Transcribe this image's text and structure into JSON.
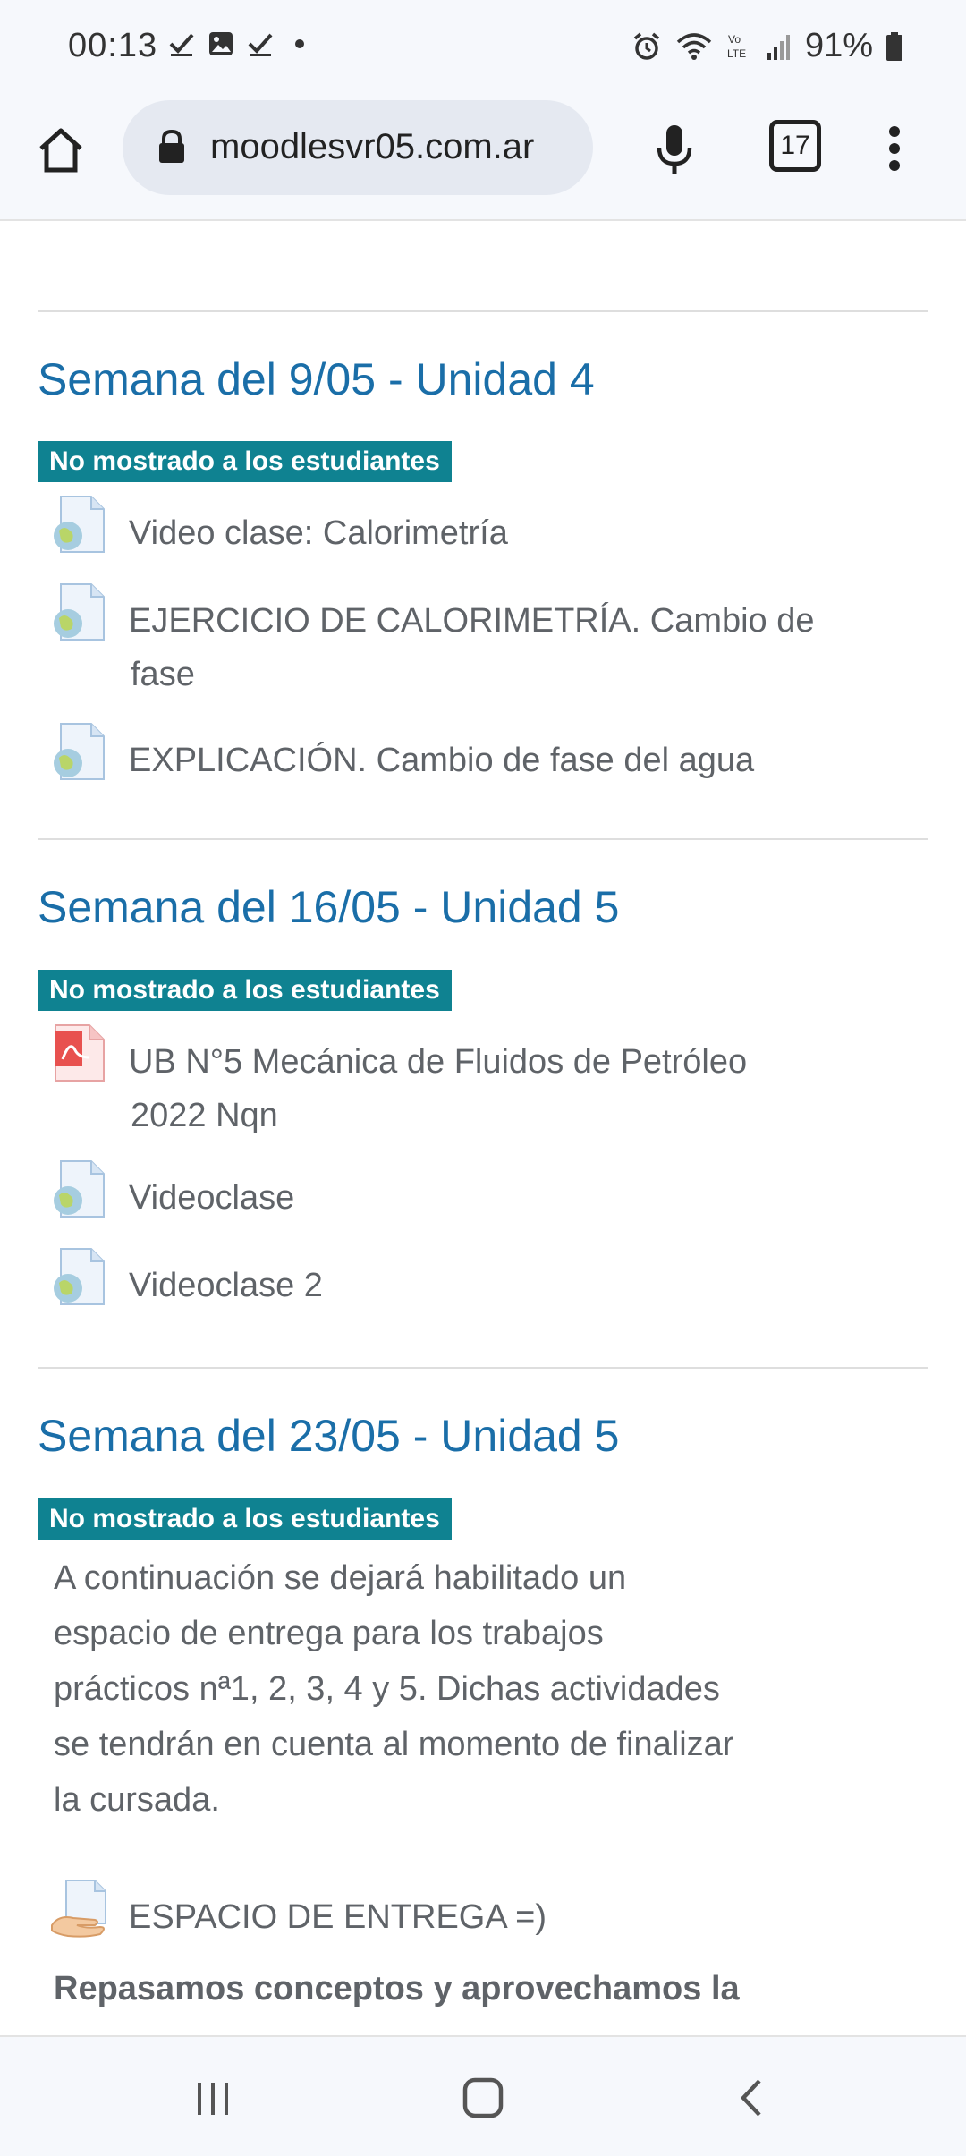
{
  "status_bar": {
    "time": "00:13",
    "battery_percent": "91%",
    "left_icons": [
      "check-icon",
      "image-icon",
      "check-icon",
      "dot-icon"
    ],
    "right_icons": [
      "alarm-icon",
      "wifi-icon",
      "volte-icon",
      "signal-icon",
      "battery-icon"
    ]
  },
  "browser": {
    "url": "moodlesvr05.com.ar",
    "tab_count": "17"
  },
  "sections": [
    {
      "title": "Semana del 9/05 - Unidad 4",
      "badge": "No mostrado a los estudiantes",
      "activities": [
        {
          "icon": "web-resource-icon",
          "label": "Video clase: Calorimetría"
        },
        {
          "icon": "web-resource-icon",
          "label_line1": "EJERCICIO DE CALORIMETRÍA. Cambio de",
          "label_line2": "fase"
        },
        {
          "icon": "web-resource-icon",
          "label": "EXPLICACIÓN. Cambio de fase del agua"
        }
      ]
    },
    {
      "title": "Semana del 16/05 - Unidad 5",
      "badge": "No mostrado a los estudiantes",
      "activities": [
        {
          "icon": "pdf-file-icon",
          "label_line1": "UB N°5 Mecánica de Fluidos de Petróleo",
          "label_line2": "2022 Nqn"
        },
        {
          "icon": "web-resource-icon",
          "label": "Videoclase"
        },
        {
          "icon": "web-resource-icon",
          "label": "Videoclase 2"
        }
      ]
    },
    {
      "title": "Semana del 23/05 - Unidad 5",
      "badge": "No mostrado a los estudiantes",
      "summary_lines": [
        "A continuación se dejará habilitado un",
        "espacio de entrega para los trabajos",
        "prácticos nª1, 2, 3, 4 y 5. Dichas actividades",
        "se tendrán en cuenta al momento de finalizar",
        "la cursada."
      ],
      "activities": [
        {
          "icon": "assignment-icon",
          "label": "ESPACIO DE ENTREGA =)"
        }
      ],
      "bold_text": "Repasamos conceptos y aprovechamos la"
    }
  ],
  "colors": {
    "link_blue": "#1a6ea8",
    "badge_teal": "#0f8291",
    "text_gray": "#5f6368"
  }
}
